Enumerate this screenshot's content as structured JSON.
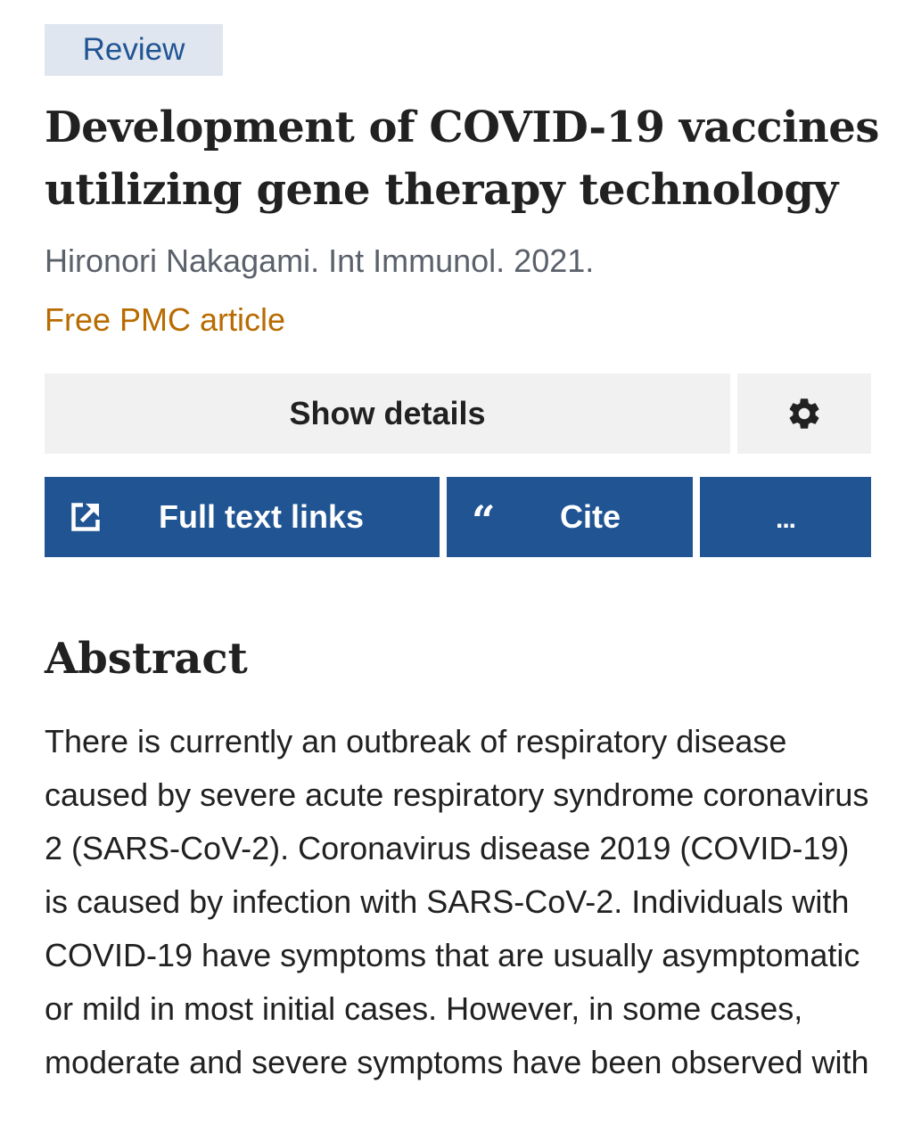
{
  "article": {
    "type_badge": "Review",
    "title": "Development of COVID-19 vaccines utilizing gene therapy technology",
    "citation": "Hironori Nakagami. Int Immunol. 2021.",
    "free_access": "Free PMC article"
  },
  "actions": {
    "show_details_label": "Show details",
    "settings_icon": "gear-icon",
    "full_text_label": "Full text links",
    "full_text_icon": "external-link-icon",
    "cite_label": "Cite",
    "cite_icon": "quote-icon",
    "cite_glyph": "“",
    "more_label": "..."
  },
  "abstract": {
    "heading": "Abstract",
    "text": "There is currently an outbreak of respiratory disease caused by severe acute respiratory syndrome coronavirus 2 (SARS-CoV-2). Coronavirus disease 2019 (COVID-19) is caused by infection with SARS-CoV-2. Individuals with COVID-19 have symptoms that are usually asymptomatic or mild in most initial cases. However, in some cases, moderate and severe symptoms have been observed with"
  },
  "colors": {
    "accent_blue": "#205493",
    "badge_bg": "#dfe6ef",
    "free_article": "#b86b00",
    "button_gray": "#f1f1f1"
  }
}
